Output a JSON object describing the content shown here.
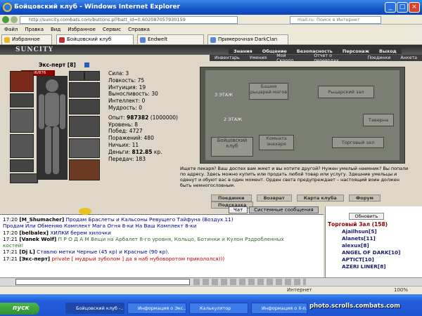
{
  "window": {
    "title": "Бойцовский клуб - Windows Internet Explorer",
    "url": "http://suncity.combats.com/buttons.pl?batt_id=0.602087057930159",
    "search_placeholder": "mail.ru: Поиск в Интернет"
  },
  "menu": [
    "Файл",
    "Правка",
    "Вид",
    "Избранное",
    "Сервис",
    "Справка"
  ],
  "tabs": [
    "Избранное",
    "Бойцовский клуб",
    "Endwelt",
    "Примерочная DarkClan"
  ],
  "game": {
    "logo": "SUNCITY",
    "nav_top": [
      "Знания",
      "Общение",
      "Безопасность",
      "Персонаж",
      "Выход"
    ],
    "nav_sub": [
      "Инвентарь",
      "Умения",
      "Мой Скролл",
      "Отчет о переводах",
      "Поединки",
      "Анкета"
    ],
    "character": {
      "name": "Экс-перт",
      "level": "[8]",
      "hp": "366/876"
    },
    "stats": [
      {
        "label": "Сила:",
        "value": "3"
      },
      {
        "label": "Ловкость:",
        "value": "75"
      },
      {
        "label": "Интуиция:",
        "value": "19"
      },
      {
        "label": "Выносливость:",
        "value": "30"
      },
      {
        "label": "Интеллект:",
        "value": "0"
      },
      {
        "label": "Мудрость:",
        "value": "0"
      }
    ],
    "info": [
      {
        "label": "Опыт:",
        "value": "987382",
        "extra": "(1000000)"
      },
      {
        "label": "Уровень:",
        "value": "8"
      },
      {
        "label": "Побед:",
        "value": "4727"
      },
      {
        "label": "Поражений:",
        "value": "480"
      },
      {
        "label": "Ничьих:",
        "value": "11"
      },
      {
        "label": "Деньги:",
        "value": "812.85",
        "extra": "кр."
      },
      {
        "label": "Передач:",
        "value": "183"
      }
    ],
    "map_labels": [
      "3 ЭТАЖ",
      "Башня рыцарей-магов",
      "Рыцарский зал",
      "2 ЭТАЖ",
      "Таверна",
      "Бойцовский клуб",
      "Комната знахаря",
      "Торговый зал"
    ],
    "map_text": "Ищете лекаря? Ваш доспех вам жмет и вы хотите другой? Нужен умелый наемник? Вы попали по адресу. Здесь можно купить или продать любой товар или услугу. Здешние умельцы и оденут и обуют вас в один момент. Орден света предупреждает – настоящий воин должен быть немногословным.",
    "buttons": [
      "Поединки",
      "Возврат",
      "Карта клуба",
      "Форум",
      "Подсказка"
    ],
    "chat_tabs": [
      "Чат",
      "Системные сообщения"
    ]
  },
  "chat": [
    {
      "time": "17:20",
      "nick": "[M_Shumacher]",
      "text": "Продам Браслеты и Кальсоны Ревущего Тайфуна (Воздух 11)",
      "cls": "msg-blue"
    },
    {
      "time": "",
      "nick": "",
      "text": "Продам Или Обменяю Комплект Мага Огня 8-ки На Ваш Комплект 8-ки",
      "cls": "msg-blue"
    },
    {
      "time": "17:20",
      "nick": "[belbalex]",
      "text": "ХИЛКИ берем хилочки",
      "cls": "msg-blue"
    },
    {
      "time": "17:21",
      "nick": "[Vanek Wolf]",
      "text": "П Р О Д А М Вещи на Арбалет 8-го уровня, Кольцо, Ботинки и Кулон Рздробленных",
      "cls": "msg-green"
    },
    {
      "time": "",
      "nick": "",
      "text": "костей!",
      "cls": "msg-green"
    },
    {
      "time": "17:21",
      "nick": "[Dj L]",
      "text": "Ставлю метки Черные (45 кр) и Красные (90 кр).",
      "cls": "msg-blue"
    },
    {
      "time": "17:21",
      "nick": "[Экс-перт]",
      "text": "private [ мудрый зуболом ] да я наб нубоворотом прикололся)))",
      "cls": "msg-red"
    }
  ],
  "online": {
    "refresh": "Обновить",
    "room": "Торговый Зал (158)",
    "players": [
      "Ajailhsun[5]",
      "Alanets[11]",
      "alexux[8]",
      "ANGEL OF DARK[10]",
      "APTICT[10]",
      "AZERI LINER[8]"
    ]
  },
  "status": {
    "left": "",
    "right": "Интернет",
    "zoom": "100%"
  },
  "taskbar": {
    "start": "пуск",
    "items": [
      "Бойцовский клуб -...",
      "Информация о Экс...",
      "Калькулятор",
      "Информация о II-п..."
    ],
    "watermark": "photo.scrolls.combats.com"
  }
}
